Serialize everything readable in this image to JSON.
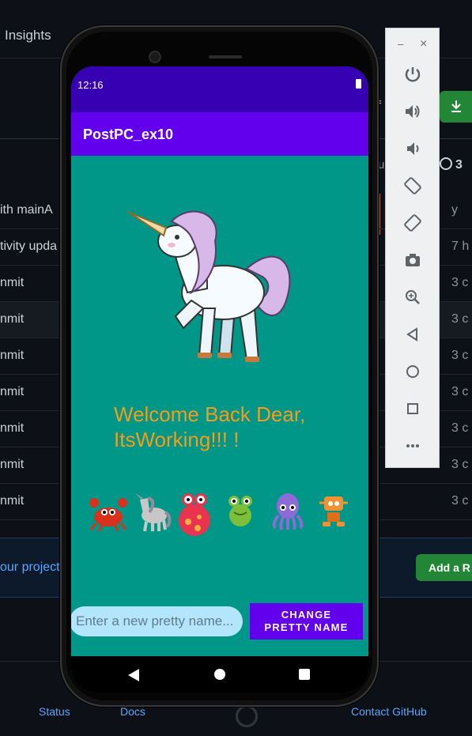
{
  "github": {
    "tab_insights": "Insights",
    "partial_button_f": "f",
    "partial_text_u": "u",
    "history_count": "3",
    "commits": [
      {
        "message": "ith mainA",
        "age": "y"
      },
      {
        "message": "tivity upda",
        "age": "7 h"
      },
      {
        "message": "nmit",
        "age": "3 c"
      },
      {
        "message": "nmit",
        "age": "3 c"
      },
      {
        "message": "nmit",
        "age": "3 c"
      },
      {
        "message": "nmit",
        "age": "3 c"
      },
      {
        "message": "nmit",
        "age": "3 c"
      },
      {
        "message": "nmit",
        "age": "3 c"
      },
      {
        "message": "nmit",
        "age": "3 c"
      }
    ],
    "banner_text": "our project",
    "banner_button": "Add a R",
    "footer": {
      "status": "Status",
      "docs": "Docs",
      "contact": "Contact GitHub"
    }
  },
  "phone": {
    "status_time": "12:16",
    "app_title": "PostPC_ex10",
    "welcome_line1": "Welcome Back Dear,",
    "welcome_line2": "ItsWorking!!! !",
    "input_placeholder": "Enter a new pretty name...",
    "change_button_line1": "CHANGE",
    "change_button_line2": "PRETTY NAME",
    "characters": [
      "crab-icon",
      "unicorn-icon",
      "monster-icon",
      "frog-icon",
      "octopus-icon",
      "robot-icon"
    ]
  },
  "emulator": {
    "minimize": "–",
    "close": "×",
    "tools": [
      "power-icon",
      "volume-up-icon",
      "volume-down-icon",
      "rotate-left-icon",
      "rotate-right-icon",
      "camera-icon",
      "zoom-icon",
      "back-icon",
      "home-icon",
      "overview-icon",
      "more-icon"
    ]
  },
  "colors": {
    "status_bar": "#3700b3",
    "app_bar": "#6200ee",
    "screen_bg": "#009688",
    "welcome_text": "#f59c1a",
    "input_bg": "#b3e5fc",
    "github_bg": "#0d1117",
    "github_green": "#238636"
  }
}
